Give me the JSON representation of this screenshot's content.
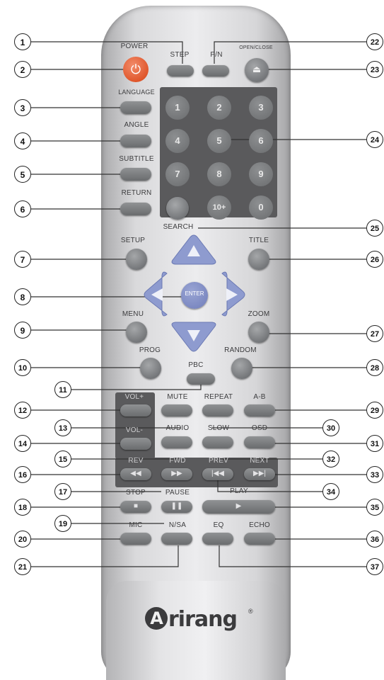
{
  "labels": {
    "power": "POWER",
    "step": "STEP",
    "pn": "P/N",
    "openclose": "OPEN/CLOSE",
    "language": "LANGUAGE",
    "angle": "ANGLE",
    "subtitle": "SUBTITLE",
    "return": "RETURN",
    "search": "SEARCH",
    "setup": "SETUP",
    "title": "TITLE",
    "enter": "ENTER",
    "menu": "MENU",
    "zoom": "ZOOM",
    "prog": "PROG",
    "random": "RANDOM",
    "pbc": "PBC",
    "volplus": "VOL+",
    "mute": "MUTE",
    "repeat": "REPEAT",
    "ab": "A-B",
    "volminus": "VOL-",
    "audio": "AUDIO",
    "slow": "SLOW",
    "osd": "OSD",
    "rev": "REV",
    "fwd": "FWD",
    "prev": "PREV",
    "next": "NEXT",
    "stop": "STOP",
    "pause": "PAUSE",
    "play": "PLAY",
    "mic": "MIC",
    "nsa": "N/SA",
    "eq": "EQ",
    "echo": "ECHO"
  },
  "numpad": [
    "1",
    "2",
    "3",
    "4",
    "5",
    "6",
    "7",
    "8",
    "9",
    "10+",
    "0"
  ],
  "brand": {
    "name": "rirang",
    "initial": "A",
    "reg": "®"
  },
  "callouts": [
    "1",
    "2",
    "3",
    "4",
    "5",
    "6",
    "7",
    "8",
    "9",
    "10",
    "11",
    "12",
    "13",
    "14",
    "15",
    "16",
    "17",
    "18",
    "19",
    "20",
    "21",
    "22",
    "23",
    "24",
    "25",
    "26",
    "27",
    "28",
    "29",
    "30",
    "31",
    "32",
    "33",
    "34",
    "35",
    "36",
    "37"
  ],
  "colors": {
    "power": "#e0572c",
    "arrows": "#8a9ad0",
    "body": "#dcdcde",
    "buttons": "#7a7c7e"
  }
}
